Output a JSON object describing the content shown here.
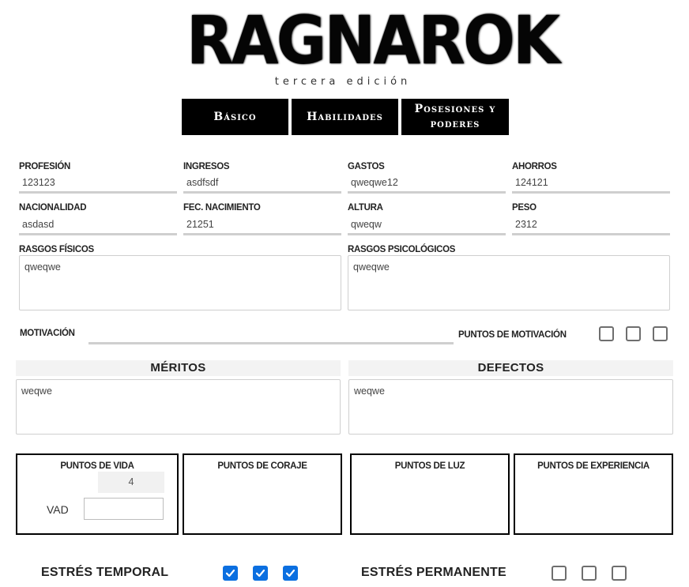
{
  "header": {
    "logo_text": "RAGNAROK",
    "subtitle": "tercera edición"
  },
  "tabs": [
    {
      "label": "Básico"
    },
    {
      "label": "Habilidades"
    },
    {
      "label": "Posesiones y poderes"
    }
  ],
  "fields": {
    "profesion": {
      "label": "PROFESIÓN",
      "value": "123123"
    },
    "ingresos": {
      "label": "INGRESOS",
      "value": "asdfsdf"
    },
    "gastos": {
      "label": "GASTOS",
      "value": "qweqwe12"
    },
    "ahorros": {
      "label": "AHORROS",
      "value": "124121"
    },
    "nacionalidad": {
      "label": "NACIONALIDAD",
      "value": "asdasd"
    },
    "fec_nacimiento": {
      "label": "FEC. NACIMIENTO",
      "value": "21251"
    },
    "altura": {
      "label": "ALTURA",
      "value": "qweqw"
    },
    "peso": {
      "label": "PESO",
      "value": "2312"
    },
    "rasgos_fisicos": {
      "label": "RASGOS FÍSICOS",
      "value": "qweqwe"
    },
    "rasgos_psicologicos": {
      "label": "RASGOS PSICOLÓGICOS",
      "value": "qweqwe"
    },
    "motivacion": {
      "label": "MOTIVACIÓN",
      "value": ""
    }
  },
  "puntos_motivacion": {
    "label": "PUNTOS DE MOTIVACIÓN",
    "checked": [
      false,
      false,
      false
    ]
  },
  "meritos": {
    "title": "MÉRITOS",
    "value": "weqwe"
  },
  "defectos": {
    "title": "DEFECTOS",
    "value": "weqwe"
  },
  "stats": {
    "vida": {
      "label": "PUNTOS DE VIDA",
      "value": "4",
      "vad_label": "VAD",
      "vad_value": ""
    },
    "coraje": {
      "label": "PUNTOS DE CORAJE"
    },
    "luz": {
      "label": "PUNTOS DE LUZ"
    },
    "experiencia": {
      "label": "PUNTOS DE EXPERIENCIA"
    }
  },
  "estres_temporal": {
    "label": "ESTRÉS TEMPORAL",
    "checked": [
      true,
      true,
      true
    ]
  },
  "estres_permanente": {
    "label": "ESTRÉS PERMANENTE",
    "checked": [
      false,
      false,
      false
    ]
  },
  "colors": {
    "checkbox_checked": "#0b6fe0",
    "tab_bg": "#000000",
    "input_underline": "#cfcfcf"
  }
}
